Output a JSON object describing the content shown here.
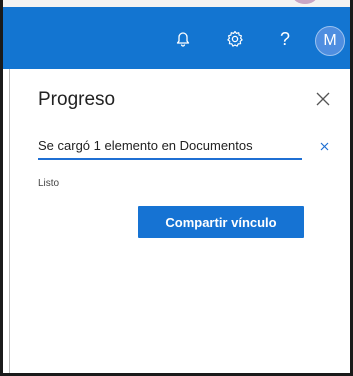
{
  "header": {
    "avatar_initial": "M",
    "help_symbol": "?",
    "icons": [
      "bell-icon",
      "gear-icon",
      "help-icon"
    ],
    "accent": "#1375d1"
  },
  "panel": {
    "title": "Progreso",
    "upload_message": "Se cargó 1 elemento en Documentos",
    "status": "Listo",
    "share_button_label": "Compartir vínculo"
  }
}
